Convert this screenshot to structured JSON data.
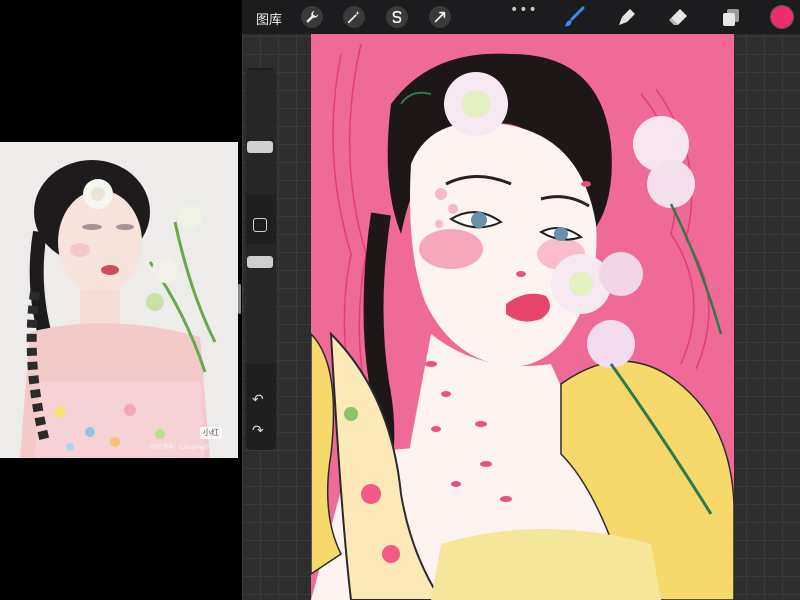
{
  "toolbar": {
    "gallery_label": "图库",
    "actions_icon": "wrench-icon",
    "adjustments_icon": "magic-wand-icon",
    "selection_icon": "selection-s-icon",
    "transform_icon": "arrow-cursor-icon",
    "more_label": "•••",
    "brush_icon": "brush-icon",
    "smudge_icon": "smudge-icon",
    "eraser_icon": "eraser-icon",
    "layers_icon": "layers-icon",
    "active_color": "#ec2d6b"
  },
  "sidebar": {
    "undo_label": "↶",
    "redo_label": "↷"
  },
  "reference": {
    "badge_text": "小红",
    "watermark_text": "小红书号：Chuqing0"
  },
  "colors": {
    "canvas_pink": "#f06a97",
    "ui_dark": "#1c1c1e",
    "brush_blue": "#3b8cf0"
  }
}
